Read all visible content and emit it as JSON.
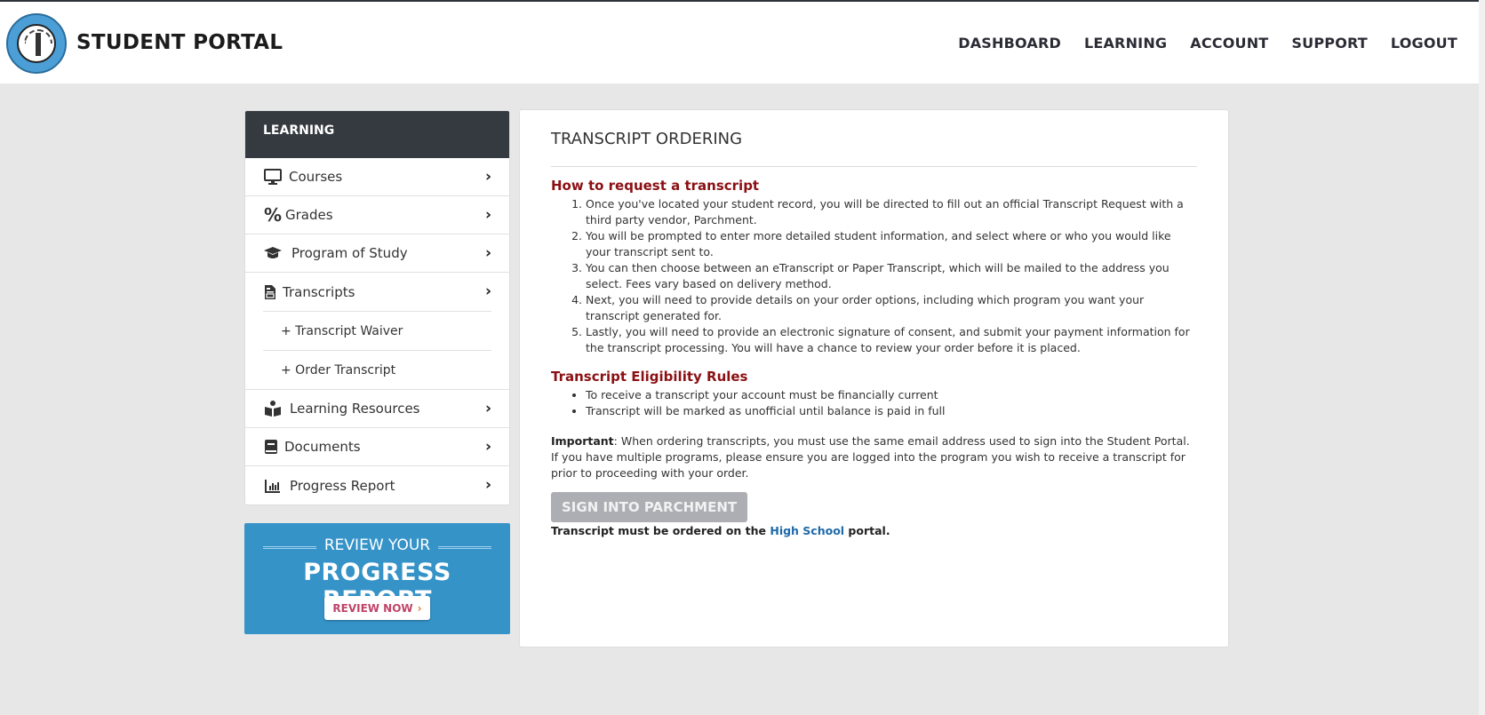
{
  "header": {
    "logo_alt": "James Madison High School seal",
    "title": "STUDENT PORTAL",
    "nav": [
      "DASHBOARD",
      "LEARNING",
      "ACCOUNT",
      "SUPPORT",
      "LOGOUT"
    ]
  },
  "sidebar": {
    "heading": "LEARNING",
    "items": [
      {
        "label": "Courses",
        "icon": "monitor-icon"
      },
      {
        "label": "Grades",
        "icon": "percent-icon"
      },
      {
        "label": "Program of Study",
        "icon": "graduation-cap-icon"
      },
      {
        "label": "Transcripts",
        "icon": "file-icon",
        "subitems": [
          "+ Transcript Waiver",
          "+ Order Transcript"
        ]
      },
      {
        "label": "Learning Resources",
        "icon": "reader-icon"
      },
      {
        "label": "Documents",
        "icon": "book-icon"
      },
      {
        "label": "Progress Report",
        "icon": "bar-chart-icon"
      }
    ]
  },
  "promo": {
    "line1": "REVIEW YOUR",
    "line2": "PROGRESS REPORT",
    "button": "REVIEW NOW",
    "button_arrow": "›"
  },
  "content": {
    "title": "TRANSCRIPT ORDERING",
    "how_heading": "How to request a transcript",
    "steps": [
      "Once you've located your student record, you will be directed to fill out an official Transcript Request with a third party vendor, Parchment.",
      "You will be prompted to enter more detailed student information, and select where or who you would like your transcript sent to.",
      "You can then choose between an eTranscript or Paper Transcript, which will be mailed to the address you select. Fees vary based on delivery method.",
      "Next, you will need to provide details on your order options, including which program you want your transcript generated for.",
      "Lastly, you will need to provide an electronic signature of consent, and submit your payment information for the transcript processing. You will have a chance to review your order before it is placed."
    ],
    "rules_heading": "Transcript Eligibility Rules",
    "rules": [
      "To receive a transcript your account must be financially current",
      "Transcript will be marked as unofficial until balance is paid in full"
    ],
    "important_label": "Important",
    "important_text": ": When ordering transcripts, you must use the same email address used to sign into the Student Portal. If you have multiple programs, please ensure you are logged into the program you wish to receive a transcript for prior to proceeding with your order.",
    "sign_button": "SIGN INTO PARCHMENT",
    "note_pre": "Transcript must be ordered on the ",
    "note_link": "High School",
    "note_post": " portal."
  },
  "colors": {
    "accent_red": "#8b1014",
    "sidebar_header": "#343a40",
    "promo_blue": "#3593c8",
    "link_blue": "#1e6aa8",
    "disabled_button": "#adaeb3"
  }
}
